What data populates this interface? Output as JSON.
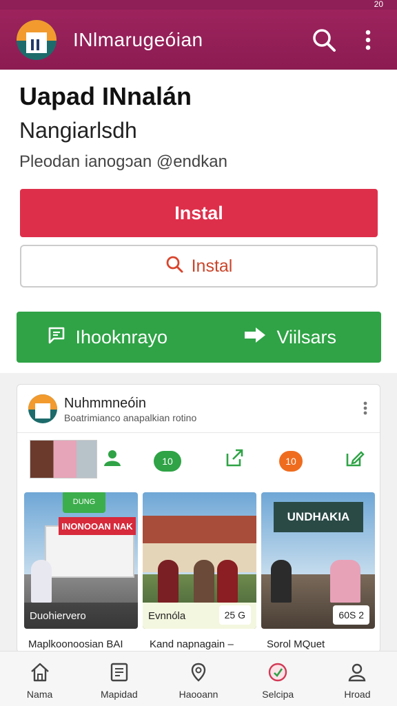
{
  "status_bar": {
    "time": "20"
  },
  "app_bar": {
    "title": "INlmarugeóian"
  },
  "hero": {
    "title": "Uapad INnalán",
    "subtitle": "Nangiarlsdh",
    "description": "Pleodan ianogɔan @endkan"
  },
  "buttons": {
    "primary_label": "Instal",
    "outline_label": "Instal",
    "green_left_label": "Ihooknrayo",
    "green_right_label": "Viilsars"
  },
  "card": {
    "title": "Nuhmmneóin",
    "subtitle": "Boatrimianco anapalkian rotino",
    "pill_1": "10",
    "pill_2": "10",
    "tiles": [
      {
        "tag": "DUNG",
        "caption": "Duohiervero",
        "truck_text": "INONOOAN NAK"
      },
      {
        "caption": "Evnnóla",
        "badge": "25 G"
      },
      {
        "sign": "UNDHAKIA",
        "badge": "60S 2"
      }
    ],
    "captions": [
      "Maplkoonoosian BAI",
      "Kand napnagain –",
      "Sorol MQuet"
    ]
  },
  "bottom_nav": {
    "items": [
      {
        "label": "Nama",
        "icon": "home-icon"
      },
      {
        "label": "Mapidad",
        "icon": "document-icon"
      },
      {
        "label": "Haooann",
        "icon": "map-pin-icon"
      },
      {
        "label": "Selcipa",
        "icon": "settings-badge-icon"
      },
      {
        "label": "Hroad",
        "icon": "profile-icon"
      }
    ]
  },
  "colors": {
    "app_bar": "#8e1f57",
    "primary_button": "#de2f4a",
    "green": "#2fa346",
    "orange_pill": "#ef6c1f"
  }
}
